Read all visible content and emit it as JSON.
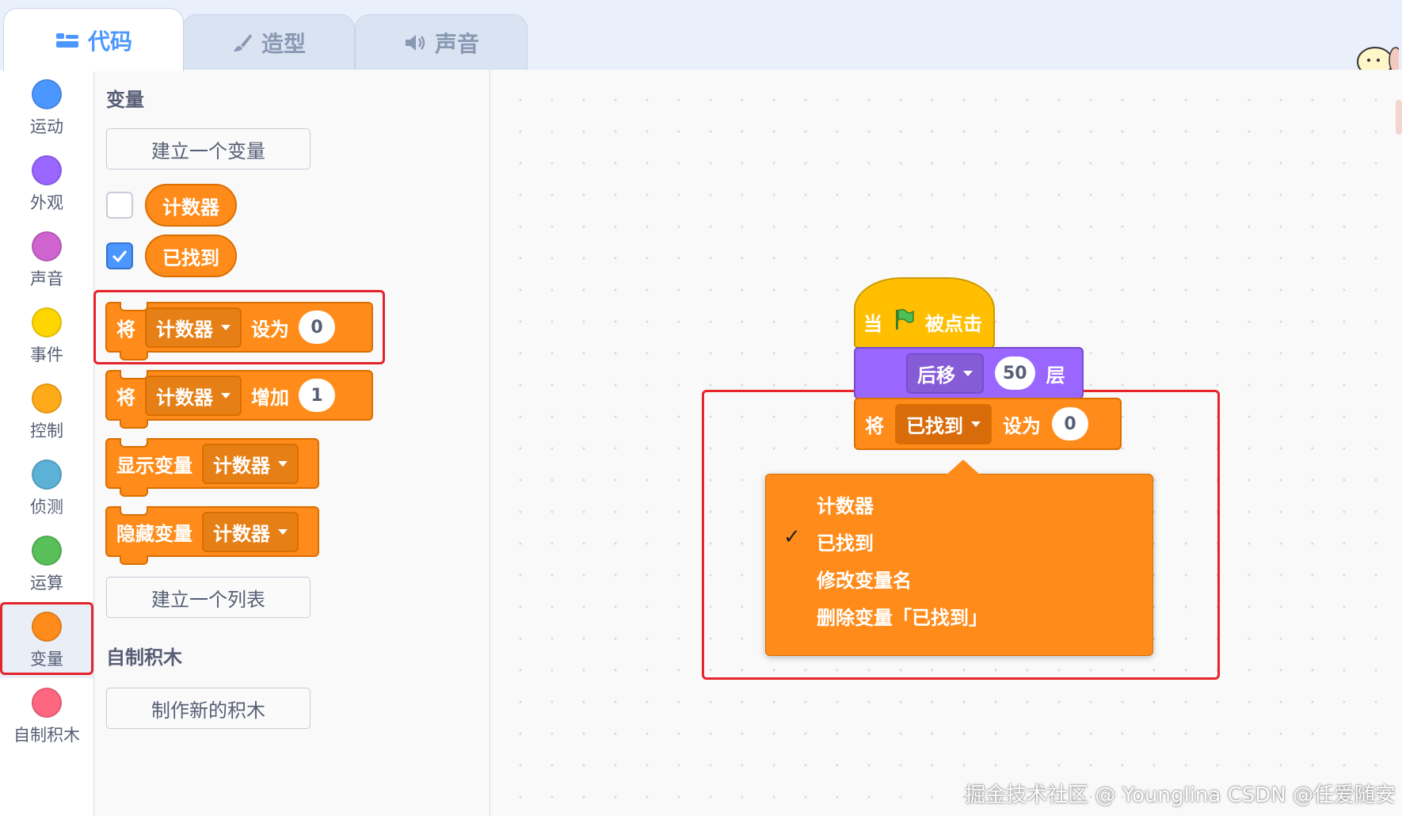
{
  "tabs": [
    {
      "label": "代码",
      "icon": "code-icon"
    },
    {
      "label": "造型",
      "icon": "brush-icon"
    },
    {
      "label": "声音",
      "icon": "speaker-icon"
    }
  ],
  "categories": [
    {
      "label": "运动",
      "color": "#4c97ff"
    },
    {
      "label": "外观",
      "color": "#9966ff"
    },
    {
      "label": "声音",
      "color": "#cf63cf"
    },
    {
      "label": "事件",
      "color": "#ffd500"
    },
    {
      "label": "控制",
      "color": "#ffab19"
    },
    {
      "label": "侦测",
      "color": "#5cb1d6"
    },
    {
      "label": "运算",
      "color": "#59c059"
    },
    {
      "label": "变量",
      "color": "#ff8c1a"
    },
    {
      "label": "自制积木",
      "color": "#ff6680"
    }
  ],
  "palette": {
    "section_variables": "变量",
    "make_variable": "建立一个变量",
    "reporters": [
      {
        "name": "计数器",
        "checked": false
      },
      {
        "name": "已找到",
        "checked": true
      }
    ],
    "set_block": {
      "prefix": "将",
      "variable": "计数器",
      "middle": "设为",
      "value": "0"
    },
    "change_block": {
      "prefix": "将",
      "variable": "计数器",
      "middle": "增加",
      "value": "1"
    },
    "show_block": {
      "prefix": "显示变量",
      "variable": "计数器"
    },
    "hide_block": {
      "prefix": "隐藏变量",
      "variable": "计数器"
    },
    "make_list": "建立一个列表",
    "section_my_blocks": "自制积木",
    "make_block": "制作新的积木"
  },
  "script": {
    "hat": {
      "prefix": "当",
      "suffix": "被点击"
    },
    "layer_block": {
      "direction": "后移",
      "value": "50",
      "suffix": "层"
    },
    "set_block": {
      "prefix": "将",
      "variable": "已找到",
      "middle": "设为",
      "value": "0"
    }
  },
  "dropdown_menu": {
    "items": [
      {
        "label": "计数器",
        "checked": false
      },
      {
        "label": "已找到",
        "checked": true
      },
      {
        "label": "修改变量名",
        "checked": false
      },
      {
        "label": "删除变量「已找到」",
        "checked": false
      }
    ],
    "check_glyph": "✓"
  },
  "watermark": "掘金技术社区 @ Younglina  CSDN @任爱随安",
  "colors": {
    "variables": "#ff8c1a",
    "looks": "#9966ff",
    "events": "#ffbf00",
    "highlight": "#e5242b",
    "accent": "#4c97ff"
  }
}
